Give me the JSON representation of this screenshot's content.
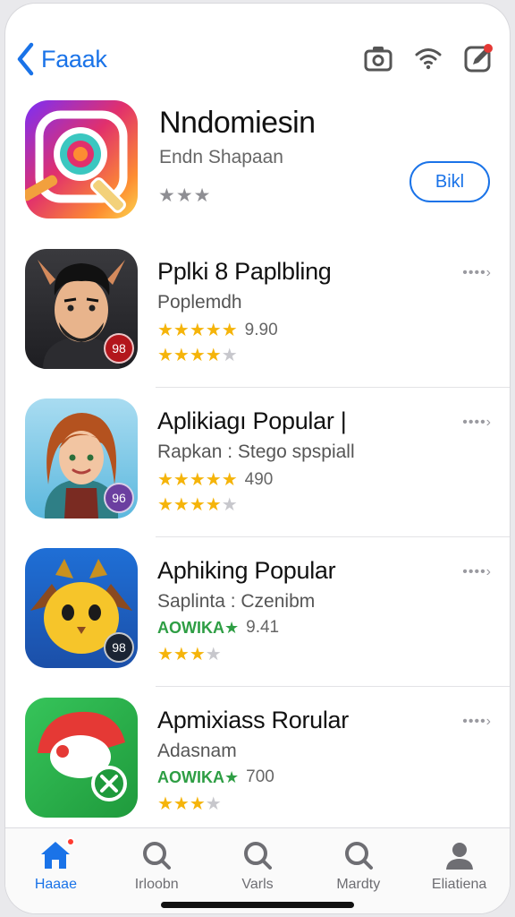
{
  "header": {
    "back_label": "Faaak",
    "icons": [
      "camera-icon",
      "wifi-icon",
      "edit-icon"
    ]
  },
  "featured": {
    "title": "Nndomiesin",
    "subtitle": "Endn Shapaan",
    "stars": "★★★",
    "get_label": "Bikl"
  },
  "apps": [
    {
      "title": "Pplki 8 Paplbling",
      "subtitle": "Poplemdh",
      "stars": "★★★★★",
      "value": "9.90",
      "stars2": "★★★★",
      "stars2_empty": "★",
      "badge": "98",
      "badge_color": "#b3161c",
      "more": "••••›"
    },
    {
      "title": "Aplikiagı Popular |",
      "subtitle": "Rapkan : Stego spspiall",
      "stars": "★★★★★",
      "value": "490",
      "stars2": "★★★★",
      "stars2_empty": "★",
      "badge": "96",
      "badge_color": "#6b3fa0",
      "more": "••••›"
    },
    {
      "title": "Aphiking Popular",
      "subtitle": "Saplinta : Czenibm",
      "stars": "AOWIKA★",
      "value": "9.41",
      "stars2": "★★★",
      "stars2_empty": "★",
      "badge": "98",
      "badge_color": "#1b2433",
      "more": "••••›"
    },
    {
      "title": "Apmixiass Rorular",
      "subtitle": "Adasnam",
      "stars": "AOWIKA★",
      "value": "700",
      "stars2": "★★★",
      "stars2_empty": "★",
      "badge": "",
      "badge_color": "#2e9e44",
      "more": "••••›"
    }
  ],
  "tabs": [
    {
      "label": "Haaae",
      "icon": "home-icon",
      "active": true
    },
    {
      "label": "Irloobn",
      "icon": "search-icon",
      "active": false
    },
    {
      "label": "Varls",
      "icon": "search-icon",
      "active": false
    },
    {
      "label": "Mardty",
      "icon": "search-icon",
      "active": false
    },
    {
      "label": "Eliatiena",
      "icon": "profile-icon",
      "active": false
    }
  ],
  "colors": {
    "accent": "#1a73e8",
    "star": "#f5b40a",
    "green_text": "#2e9e44",
    "badge_dot": "#ff3b30"
  }
}
